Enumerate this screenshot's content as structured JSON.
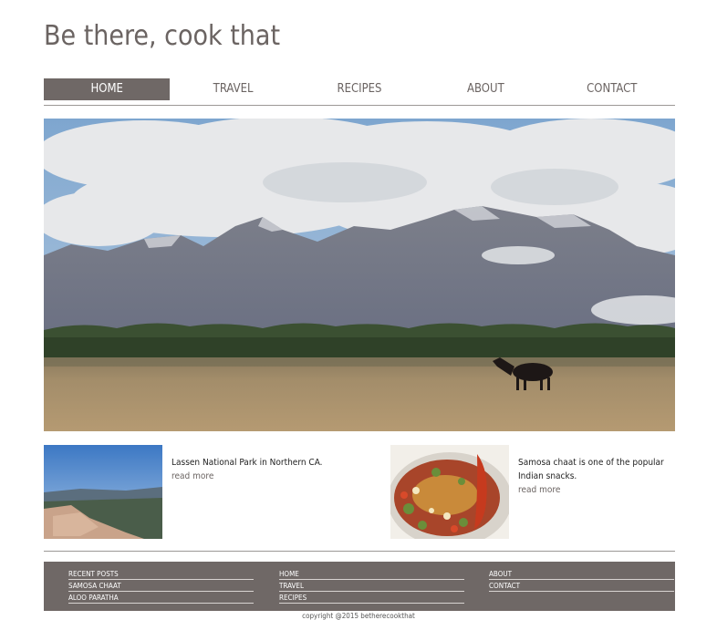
{
  "site": {
    "title": "Be there, cook that"
  },
  "nav": {
    "items": [
      {
        "label": "HOME"
      },
      {
        "label": "TRAVEL"
      },
      {
        "label": "RECIPES"
      },
      {
        "label": "ABOUT"
      },
      {
        "label": "CONTACT"
      }
    ],
    "active": "HOME"
  },
  "posts": [
    {
      "title": "Lassen National Park in Northern CA.",
      "read_more": "read more"
    },
    {
      "title": "Samosa chaat is one of the popular Indian snacks.",
      "read_more": "read more"
    }
  ],
  "footer": {
    "col1": [
      "RECENT POSTS",
      "SAMOSA CHAAT",
      "ALOO PARATHA"
    ],
    "col2": [
      "HOME",
      "TRAVEL",
      "RECIPES"
    ],
    "col3": [
      "ABOUT",
      "CONTACT"
    ],
    "copyright": "copyright @2015 betherecookthat"
  },
  "colors": {
    "accent": "#6f6866",
    "text": "#6b6462"
  }
}
